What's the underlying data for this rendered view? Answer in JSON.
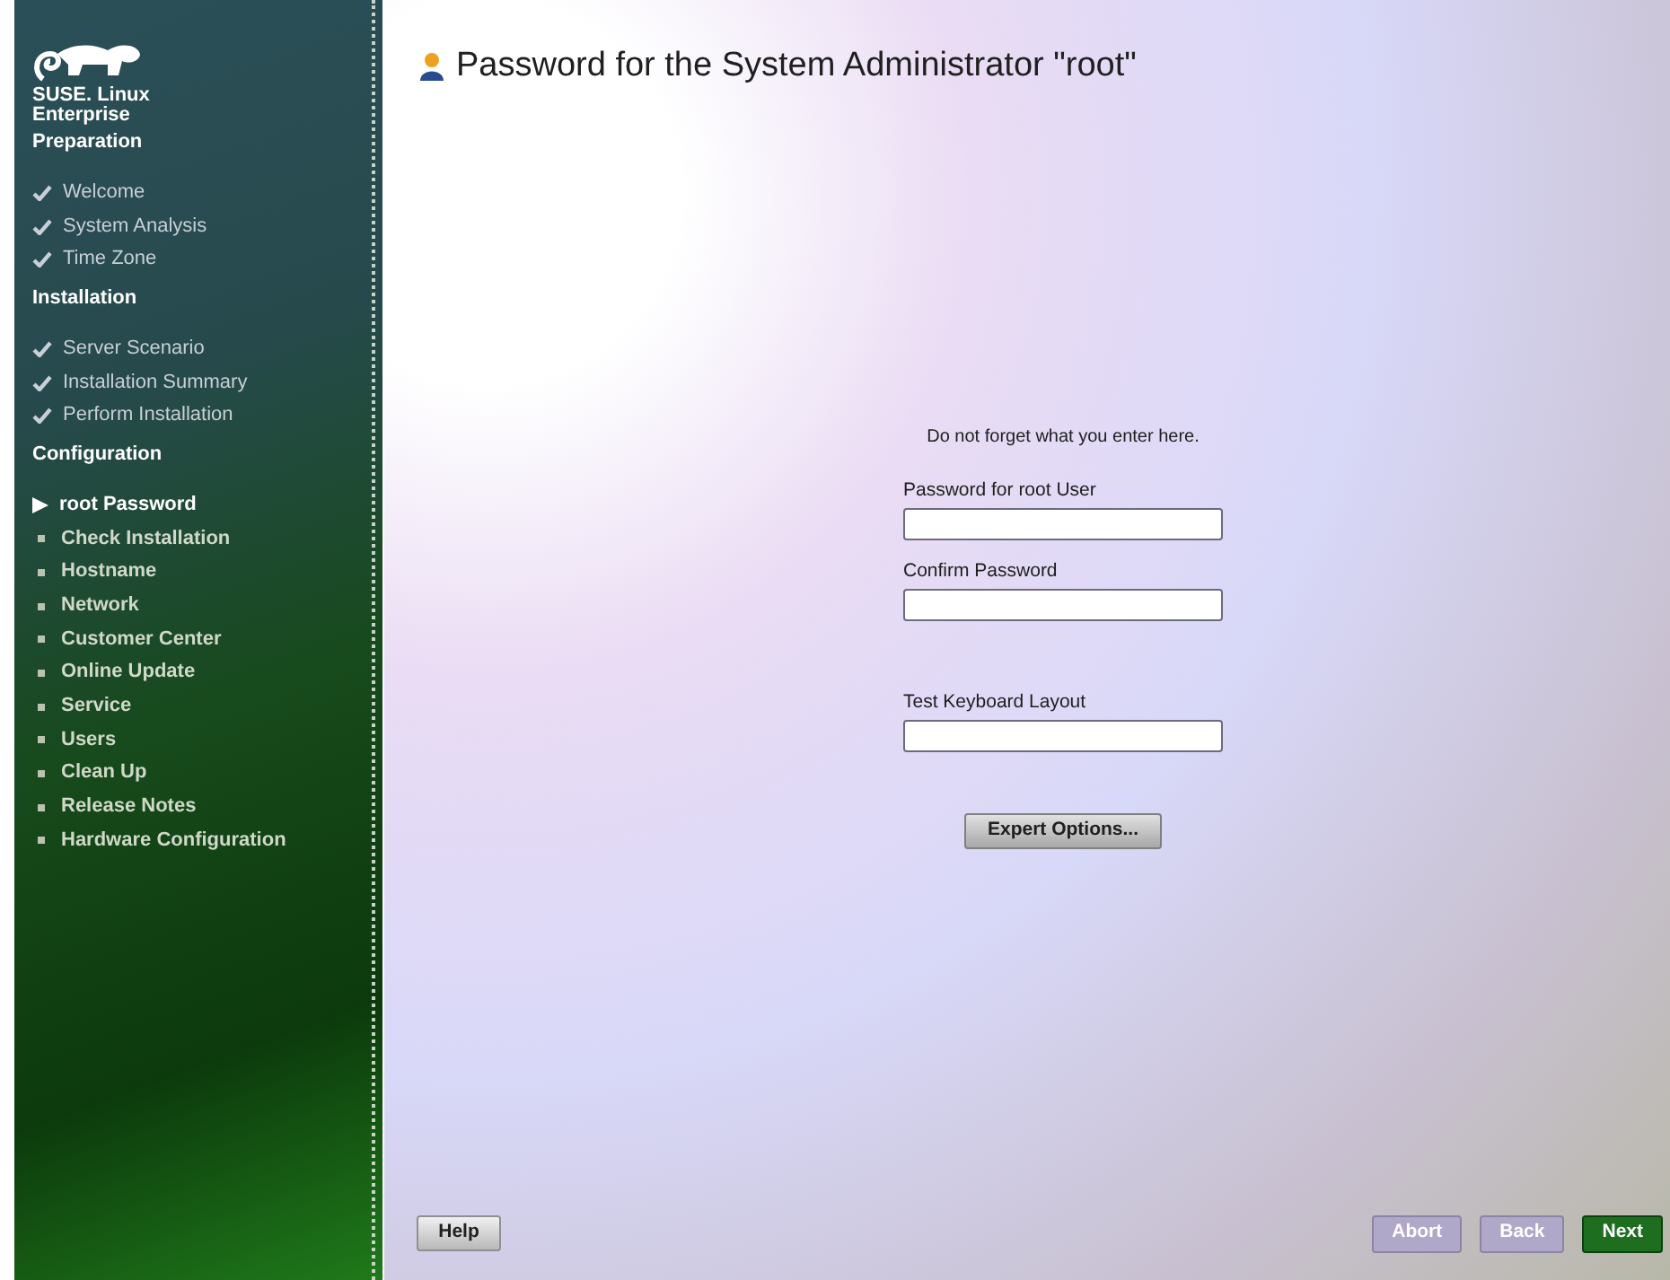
{
  "sidebar": {
    "brand": [
      "SUSE. Linux",
      "Enterprise"
    ],
    "sections": [
      {
        "title": "Preparation",
        "items": [
          {
            "label": "Welcome",
            "kind": "done"
          },
          {
            "label": "System Analysis",
            "kind": "done"
          },
          {
            "label": "Time Zone",
            "kind": "done"
          }
        ]
      },
      {
        "title": "Installation",
        "items": [
          {
            "label": "Server Scenario",
            "kind": "done"
          },
          {
            "label": "Installation Summary",
            "kind": "done"
          },
          {
            "label": "Perform Installation",
            "kind": "done"
          }
        ]
      },
      {
        "title": "Configuration",
        "items": [
          {
            "label": "root Password",
            "kind": "current"
          },
          {
            "label": "Check Installation",
            "kind": "todo"
          },
          {
            "label": "Hostname",
            "kind": "todo"
          },
          {
            "label": "Network",
            "kind": "todo"
          },
          {
            "label": "Customer Center",
            "kind": "todo"
          },
          {
            "label": "Online Update",
            "kind": "todo"
          },
          {
            "label": "Service",
            "kind": "todo"
          },
          {
            "label": "Users",
            "kind": "todo"
          },
          {
            "label": "Clean Up",
            "kind": "todo"
          },
          {
            "label": "Release Notes",
            "kind": "todo"
          },
          {
            "label": "Hardware Configuration",
            "kind": "todo"
          }
        ]
      }
    ]
  },
  "title": "Password for the System Administrator \"root\"",
  "hint": "Do not forget what you enter here.",
  "fields": [
    {
      "label": "Password for root User"
    },
    {
      "label": "Confirm Password"
    },
    {
      "label": "Test Keyboard Layout"
    }
  ],
  "expert_button": "Expert Options...",
  "help_button": "Help",
  "buttons": [
    {
      "label": "Abort",
      "kind": "disabled"
    },
    {
      "label": "Back",
      "kind": "disabled"
    },
    {
      "label": "Next",
      "kind": "primary"
    }
  ]
}
